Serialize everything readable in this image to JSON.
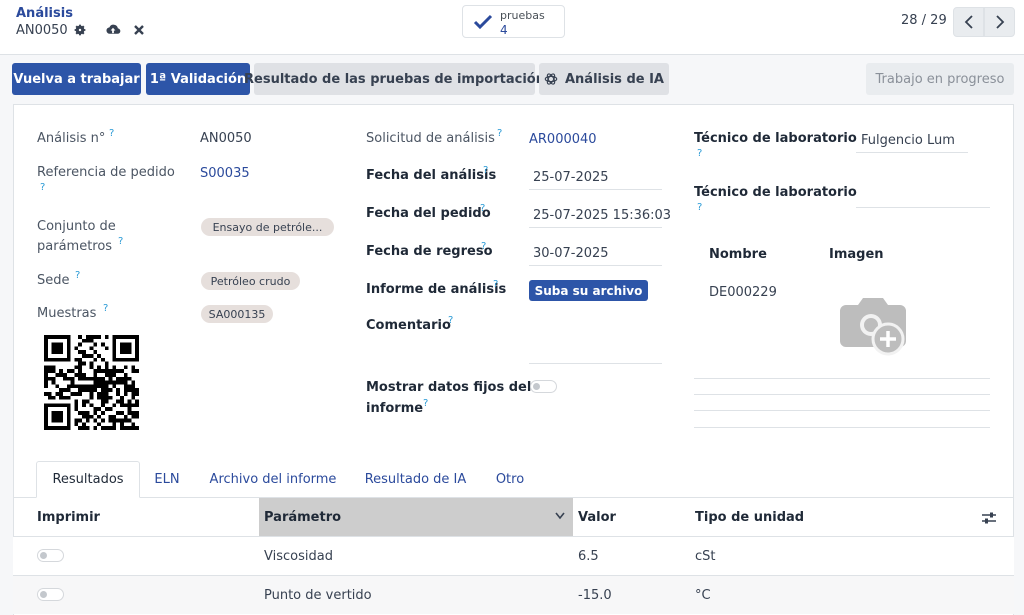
{
  "breadcrumb": {
    "parent": "Análisis",
    "current": "AN0050"
  },
  "stat_button": {
    "label": "pruebas",
    "value": "4"
  },
  "pager": {
    "text": "28 / 29"
  },
  "actions": {
    "rework": "Vuelva a trabajar",
    "validate": "1ª Validación",
    "import_results": "Resultado de las pruebas de importación",
    "ai_analysis": "Análisis de IA",
    "status": "Trabajo en progreso"
  },
  "form": {
    "analysis_no": {
      "label": "Análisis n°",
      "value": "AN0050"
    },
    "order_ref": {
      "label": "Referencia de pedido",
      "value": "S00035"
    },
    "param_set": {
      "label_1": "Conjunto de",
      "label_2": "parámetros",
      "value": "Ensayo de petróle..."
    },
    "site": {
      "label": "Sede",
      "value": "Petróleo crudo"
    },
    "samples": {
      "label": "Muestras",
      "value": "SA000135"
    },
    "request": {
      "label": "Solicitud de análisis",
      "value": "AR000040"
    },
    "analysis_date": {
      "label": "Fecha del análisis",
      "value": "25-07-2025"
    },
    "order_date": {
      "label": "Fecha del pedido",
      "value": "25-07-2025 15:36:03"
    },
    "return_date": {
      "label": "Fecha de regreso",
      "value": "30-07-2025"
    },
    "report": {
      "label": "Informe de análisis",
      "button": "Suba su archivo"
    },
    "comment": {
      "label": "Comentario"
    },
    "fixed_data": {
      "label_1": "Mostrar datos fijos del",
      "label_2": "informe"
    },
    "technician_1": {
      "label": "Técnico de laboratorio",
      "value": "Fulgencio Lum"
    },
    "technician_2": {
      "label": "Técnico de laboratorio",
      "value": ""
    },
    "subtable": {
      "col_name": "Nombre",
      "col_image": "Imagen",
      "row_name": "DE000229"
    },
    "help_mark": "?"
  },
  "tabs": [
    "Resultados",
    "ELN",
    "Archivo del informe",
    "Resultado de IA",
    "Otro"
  ],
  "list": {
    "headers": {
      "print": "Imprimir",
      "parameter": "Parámetro",
      "value": "Valor",
      "unit": "Tipo de unidad"
    },
    "rows": [
      {
        "parameter": "Viscosidad",
        "value": "6.5",
        "unit": "cSt"
      },
      {
        "parameter": "Punto de vertido",
        "value": "-15.0",
        "unit": "°C"
      }
    ]
  },
  "colors": {
    "primary": "#2d55a8",
    "link": "#2b4a9c",
    "help": "#2c9bd6",
    "tag": "#e6dfdc"
  },
  "icons": [
    "gear-icon",
    "cloud-upload-icon",
    "close-icon",
    "check-icon",
    "chevron-left-icon",
    "chevron-right-icon",
    "openai-icon",
    "camera-plus-icon",
    "qr-code-icon",
    "sliders-icon",
    "sort-caret-icon"
  ]
}
